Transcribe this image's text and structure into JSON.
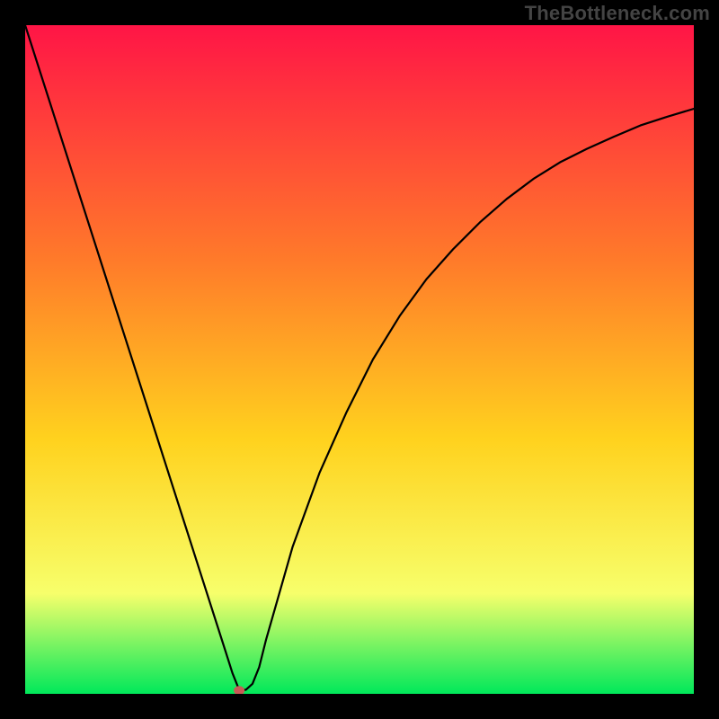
{
  "watermark": "TheBottleneck.com",
  "colors": {
    "gradient_top": "#ff1546",
    "gradient_mid_upper": "#ff7a2a",
    "gradient_mid": "#ffd21e",
    "gradient_mid_lower": "#f7ff6b",
    "gradient_green": "#00e85a",
    "frame": "#000000",
    "curve": "#000000",
    "marker": "#c95a56"
  },
  "chart_data": {
    "type": "line",
    "title": "",
    "xlabel": "",
    "ylabel": "",
    "xlim": [
      0,
      100
    ],
    "ylim": [
      0,
      100
    ],
    "annotations": [],
    "legend": [],
    "grid": false,
    "marker": {
      "x": 32,
      "y": 0.5
    },
    "series": [
      {
        "name": "bottleneck-curve",
        "x": [
          0,
          4,
          8,
          12,
          16,
          20,
          24,
          28,
          30,
          31,
          32,
          33,
          34,
          35,
          36,
          38,
          40,
          44,
          48,
          52,
          56,
          60,
          64,
          68,
          72,
          76,
          80,
          84,
          88,
          92,
          96,
          100
        ],
        "values": [
          100,
          87.5,
          75,
          62.5,
          50,
          37.5,
          25,
          12.5,
          6.25,
          3.1,
          0.6,
          0.6,
          1.5,
          4,
          8,
          15,
          22,
          33,
          42,
          50,
          56.5,
          62,
          66.5,
          70.5,
          74,
          77,
          79.5,
          81.5,
          83.3,
          85,
          86.3,
          87.5
        ]
      }
    ]
  }
}
